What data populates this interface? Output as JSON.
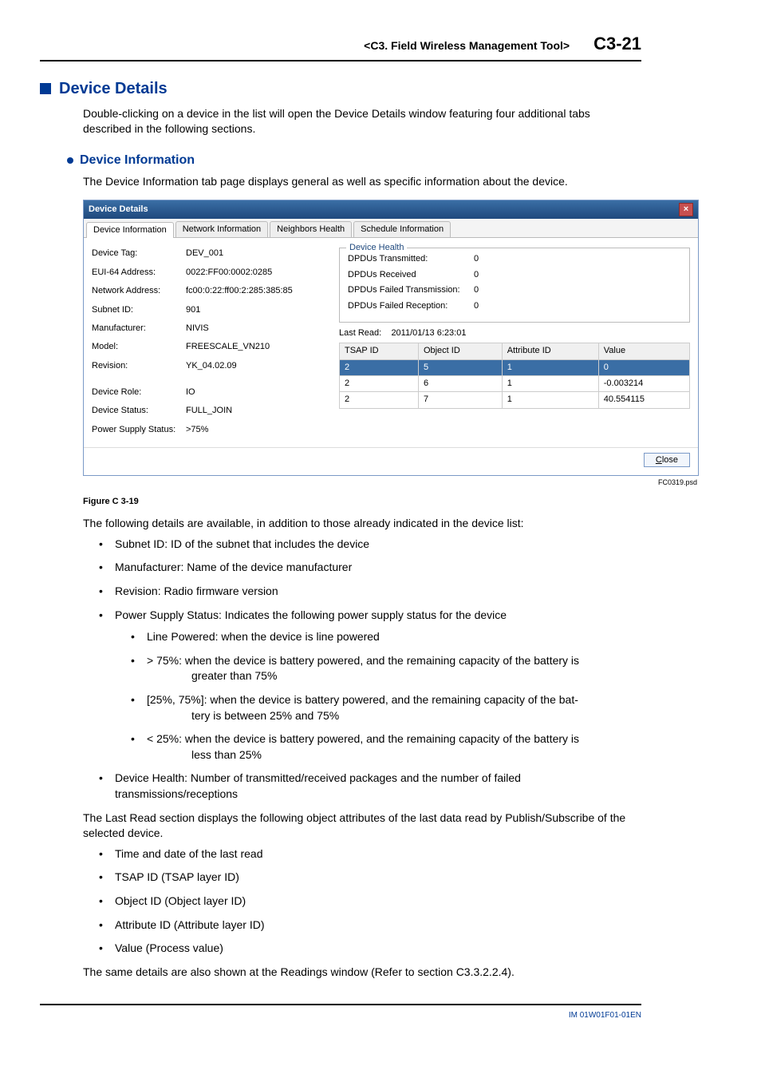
{
  "header": {
    "section": "<C3. Field Wireless Management Tool>",
    "page": "C3-21"
  },
  "h1": "Device Details",
  "intro": "Double-clicking on a device in the list will open the Device Details window featuring four additional tabs described in the following sections.",
  "h2": "Device Information",
  "sub_intro": "The Device Information tab page displays general as well as specific information about the device.",
  "window": {
    "title": "Device Details",
    "tabs": [
      "Device Information",
      "Network Information",
      "Neighbors Health",
      "Schedule Information"
    ],
    "info": {
      "device_tag_l": "Device Tag:",
      "device_tag_v": "DEV_001",
      "eui_l": "EUI-64 Address:",
      "eui_v": "0022:FF00:0002:0285",
      "net_l": "Network Address:",
      "net_v": "fc00:0:22:ff00:2:285:385:85",
      "subnet_l": "Subnet ID:",
      "subnet_v": "901",
      "manu_l": "Manufacturer:",
      "manu_v": "NIVIS",
      "model_l": "Model:",
      "model_v": "FREESCALE_VN210",
      "rev_l": "Revision:",
      "rev_v": "YK_04.02.09",
      "role_l": "Device Role:",
      "role_v": "IO",
      "status_l": "Device Status:",
      "status_v": "FULL_JOIN",
      "pss_l": "Power Supply Status:",
      "pss_v": ">75%"
    },
    "health": {
      "title": "Device Health",
      "tx_l": "DPDUs Transmitted:",
      "tx_v": "0",
      "rx_l": "DPDUs Received",
      "rx_v": "0",
      "ftx_l": "DPDUs Failed Transmission:",
      "ftx_v": "0",
      "frx_l": "DPDUs Failed Reception:",
      "frx_v": "0"
    },
    "last_read_label": "Last Read:",
    "last_read_ts": "2011/01/13 6:23:01",
    "grid_headers": [
      "TSAP ID",
      "Object ID",
      "Attribute ID",
      "Value"
    ],
    "grid_rows": [
      [
        "2",
        "5",
        "1",
        "0"
      ],
      [
        "2",
        "6",
        "1",
        "-0.003214"
      ],
      [
        "2",
        "7",
        "1",
        "40.554115"
      ]
    ],
    "close_btn": "Close"
  },
  "fig_ref": "FC0319.psd",
  "fig_caption": "Figure C 3-19",
  "para_after_fig": "The following details are available, in addition to those already indicated in the device list:",
  "bullets": {
    "b1": "Subnet ID: ID of the subnet that includes the device",
    "b2": "Manufacturer: Name of the device manufacturer",
    "b3": "Revision: Radio firmware version",
    "b4": "Power Supply Status: Indicates the following power supply status for the device",
    "b4s1": "Line Powered: when the device is line powered",
    "b4s2a": "> 75%: when the device is battery powered, and the remaining capacity of the battery is",
    "b4s2b": "greater than 75%",
    "b4s3a": "[25%, 75%]: when the device is battery powered, and the remaining capacity of the bat-",
    "b4s3b": "tery is between 25% and 75%",
    "b4s4a": "< 25%: when the device is battery powered, and the remaining capacity of the battery is",
    "b4s4b": "less than 25%",
    "b5": "Device Health: Number of transmitted/received packages and the number of failed transmissions/receptions"
  },
  "para_lastread": "The Last Read section displays the following object attributes of the last data read by  Publish/Subscribe of the selected device.",
  "bullets2": {
    "c1": "Time and date of the last read",
    "c2": "TSAP ID (TSAP layer ID)",
    "c3": "Object ID (Object layer ID)",
    "c4": "Attribute ID (Attribute layer ID)",
    "c5": "Value (Process value)"
  },
  "para_end": "The same details are also shown at the Readings window (Refer to section C3.3.2.2.4).",
  "footer": "IM 01W01F01-01EN"
}
